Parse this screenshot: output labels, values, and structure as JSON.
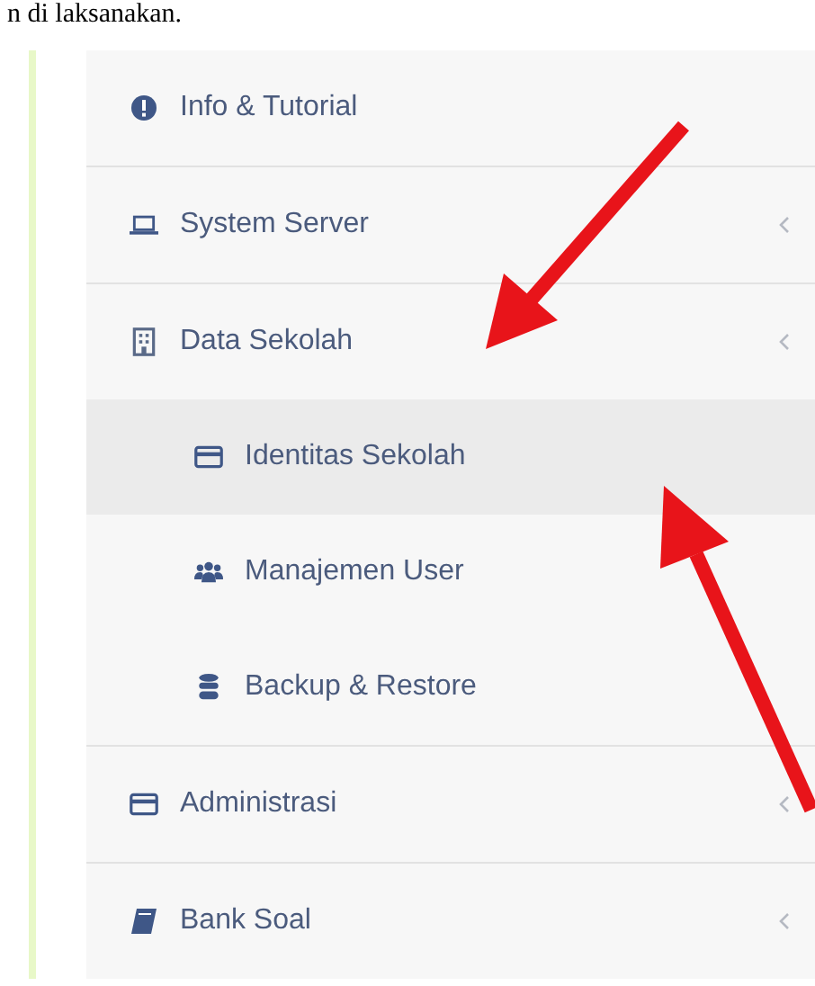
{
  "intro_text": "n di laksanakan.",
  "sidebar": {
    "items": [
      {
        "label": "Info & Tutorial",
        "selected": false,
        "expandable": false
      },
      {
        "label": "System Server",
        "selected": false,
        "expandable": true
      },
      {
        "label": "Data Sekolah",
        "selected": false,
        "expandable": true,
        "children": [
          {
            "label": "Identitas Sekolah",
            "selected": true
          },
          {
            "label": "Manajemen User",
            "selected": false
          },
          {
            "label": "Backup & Restore",
            "selected": false
          }
        ]
      },
      {
        "label": "Administrasi",
        "selected": false,
        "expandable": true
      },
      {
        "label": "Bank Soal",
        "selected": false,
        "expandable": true
      }
    ]
  }
}
